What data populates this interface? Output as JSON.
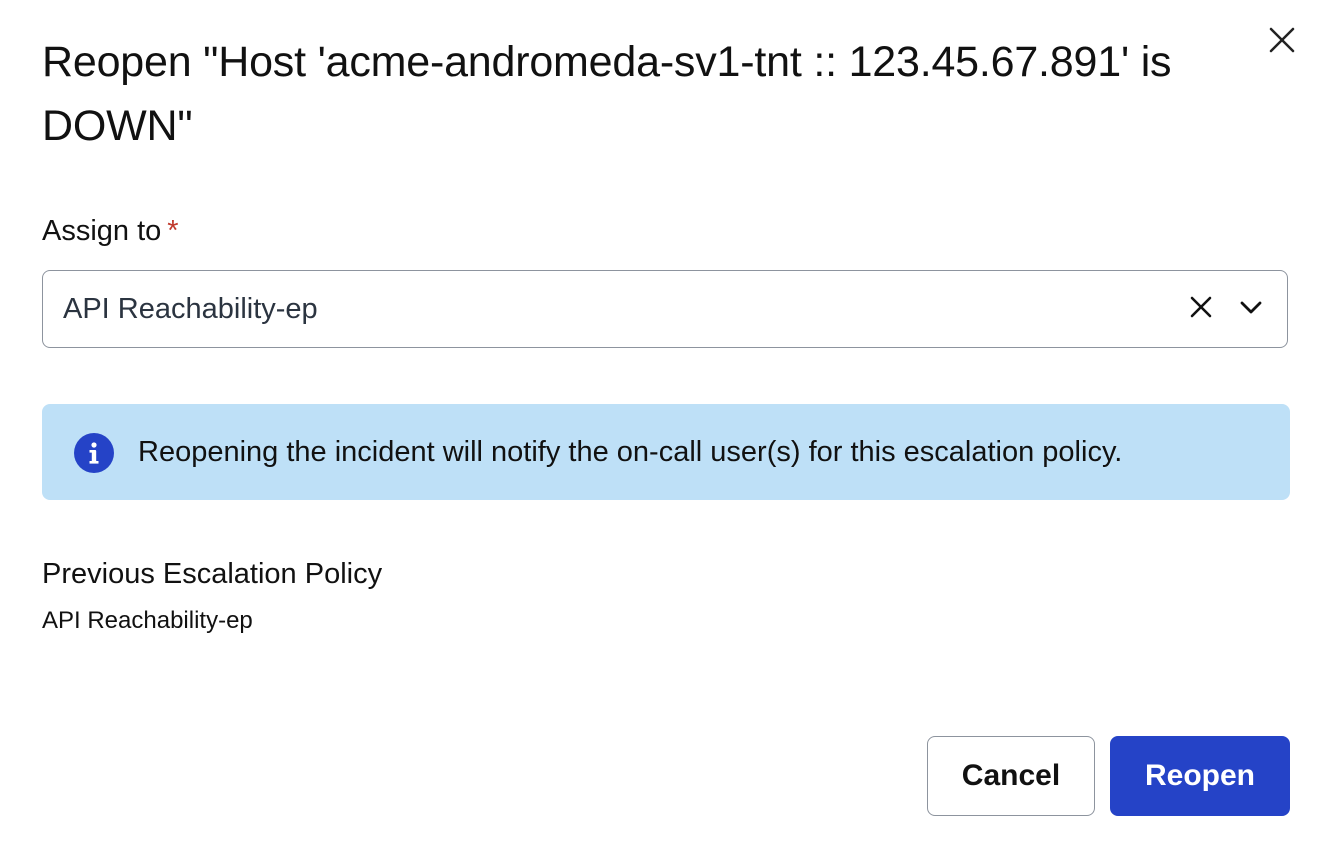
{
  "dialog": {
    "title": "Reopen \"Host 'acme-andromeda-sv1-tnt :: 123.45.67.891' is DOWN\"",
    "close_icon": "close-icon"
  },
  "assign": {
    "label": "Assign to",
    "required_marker": "*",
    "selected_value": "API Reachability-ep",
    "clear_icon": "clear-icon",
    "dropdown_icon": "chevron-down-icon"
  },
  "info": {
    "icon": "info-icon",
    "message": "Reopening the incident will notify the on-call user(s) for this escalation policy."
  },
  "previous": {
    "heading": "Previous Escalation Policy",
    "value": "API Reachability-ep"
  },
  "actions": {
    "cancel_label": "Cancel",
    "reopen_label": "Reopen"
  },
  "colors": {
    "primary": "#2543c7",
    "info_background": "#bee0f7",
    "required": "#c0392b",
    "border": "#8d949e"
  }
}
